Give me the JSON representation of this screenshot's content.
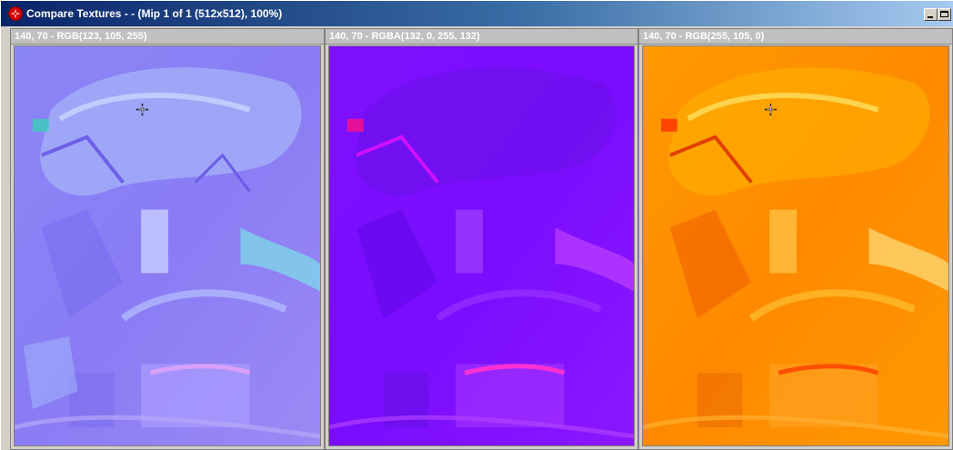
{
  "window": {
    "title": "Compare Textures -  - (Mip 1 of 1 (512x512), 100%)",
    "minimize_label": "",
    "maximize_label": ""
  },
  "panels": [
    {
      "header": "140, 70 - RGB(123, 105, 255)",
      "texture": "normal-map-purple-blue",
      "base_color": "#8a7cf4"
    },
    {
      "header": "140, 70 - RGBA(132, 0, 255, 132)",
      "texture": "normal-map-violet",
      "base_color": "#7a10ff"
    },
    {
      "header": "140, 70 - RGB(255, 105, 0)",
      "texture": "normal-map-orange",
      "base_color": "#ff8a00"
    }
  ],
  "icons": {
    "app": "app-logo-icon",
    "cursor": "crosshair-cursor-icon"
  }
}
